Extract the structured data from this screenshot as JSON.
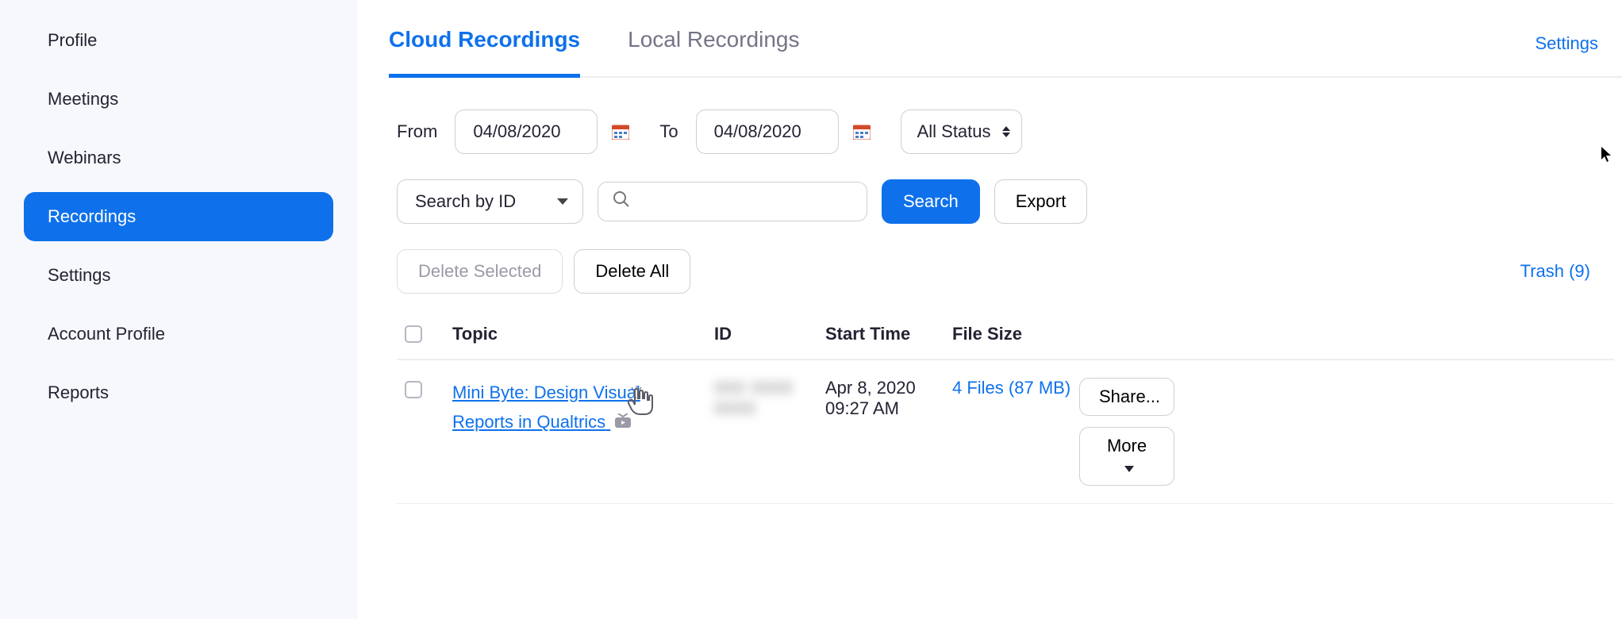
{
  "sidebar": {
    "items": [
      {
        "label": "Profile"
      },
      {
        "label": "Meetings"
      },
      {
        "label": "Webinars"
      },
      {
        "label": "Recordings"
      },
      {
        "label": "Settings"
      },
      {
        "label": "Account Profile"
      },
      {
        "label": "Reports"
      }
    ]
  },
  "tabs": {
    "cloud": "Cloud Recordings",
    "local": "Local Recordings"
  },
  "settings_link": "Settings",
  "filters": {
    "from_label": "From",
    "to_label": "To",
    "from_value": "04/08/2020",
    "to_value": "04/08/2020",
    "status": "All Status",
    "search_by": "Search by ID"
  },
  "buttons": {
    "search": "Search",
    "export": "Export",
    "delete_selected": "Delete Selected",
    "delete_all": "Delete All",
    "share": "Share...",
    "more": "More"
  },
  "trash": "Trash (9)",
  "columns": {
    "topic": "Topic",
    "id": "ID",
    "start": "Start Time",
    "size": "File Size"
  },
  "rows": [
    {
      "topic": "Mini Byte: Design Visual Reports in Qualtrics",
      "id": "000 0000 0000",
      "start": "Apr 8, 2020 09:27 AM",
      "size": "4 Files (87 MB)"
    }
  ]
}
